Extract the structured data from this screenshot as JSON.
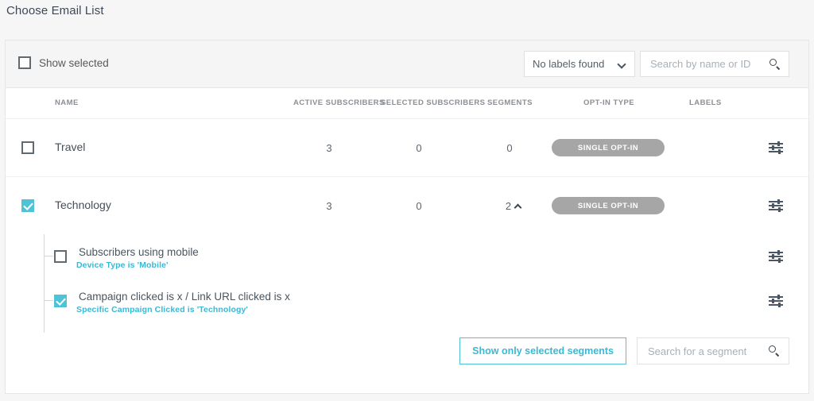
{
  "page_title": "Choose Email List",
  "toolbar": {
    "show_selected_label": "Show selected",
    "labels_dropdown": {
      "value": "No labels found",
      "icon": "chevron-down-icon"
    },
    "search": {
      "placeholder": "Search by name or ID",
      "value": "",
      "icon": "search-icon"
    }
  },
  "table": {
    "columns": [
      "NAME",
      "ACTIVE SUBSCRIBERS",
      "SELECTED SUBSCRIBERS",
      "SEGMENTS",
      "OPT-IN TYPE",
      "LABELS"
    ],
    "rows": [
      {
        "name": "Travel",
        "checked": false,
        "active_subscribers": "3",
        "selected_subscribers": "0",
        "segments": "0",
        "opt_in_type": "SINGLE OPT-IN",
        "labels": "",
        "expanded": false,
        "row_icon": "sliders-icon"
      },
      {
        "name": "Technology",
        "checked": true,
        "active_subscribers": "3",
        "selected_subscribers": "0",
        "segments": "2",
        "opt_in_type": "SINGLE OPT-IN",
        "labels": "",
        "expanded": true,
        "expand_icon": "chevron-up-icon",
        "row_icon": "sliders-icon"
      }
    ]
  },
  "segments": {
    "items": [
      {
        "title": "Subscribers using mobile",
        "rule": "Device Type is 'Mobile'",
        "checked": false,
        "row_icon": "sliders-icon"
      },
      {
        "title": "Campaign clicked is x / Link URL clicked is x",
        "rule": "Specific Campaign Clicked is 'Technology'",
        "checked": true,
        "row_icon": "sliders-icon"
      }
    ],
    "footer": {
      "show_only_selected_label": "Show only selected segments",
      "search": {
        "placeholder": "Search for a segment",
        "value": "",
        "icon": "search-icon"
      }
    }
  },
  "colors": {
    "accent_teal": "#4ec3d8",
    "pill_gray": "#a6a6a6",
    "title_text": "#3c4858"
  }
}
